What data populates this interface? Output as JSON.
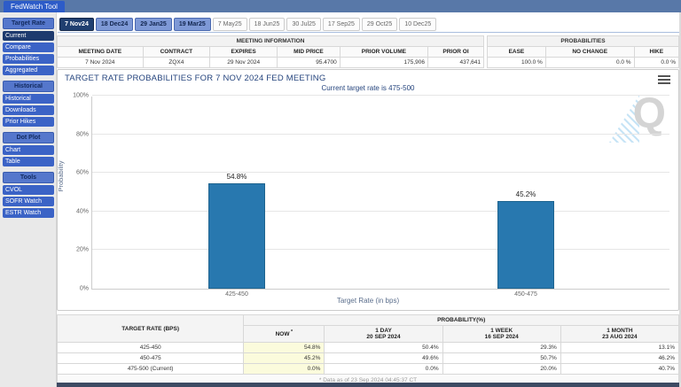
{
  "header": {
    "app_title": "FedWatch Tool"
  },
  "sidebar": {
    "sections": [
      {
        "label": "Target Rate",
        "items": [
          {
            "label": "Current",
            "active": true
          },
          {
            "label": "Compare",
            "active": false
          },
          {
            "label": "Probabilities",
            "active": false
          },
          {
            "label": "Aggregated",
            "active": false
          }
        ]
      },
      {
        "label": "Historical",
        "items": [
          {
            "label": "Historical",
            "active": false
          },
          {
            "label": "Downloads",
            "active": false
          },
          {
            "label": "Prior Hikes",
            "active": false
          }
        ]
      },
      {
        "label": "Dot Plot",
        "items": [
          {
            "label": "Chart",
            "active": false
          },
          {
            "label": "Table",
            "active": false
          }
        ]
      },
      {
        "label": "Tools",
        "items": [
          {
            "label": "CVOL",
            "active": false
          },
          {
            "label": "SOFR Watch",
            "active": false
          },
          {
            "label": "ESTR Watch",
            "active": false
          }
        ]
      }
    ]
  },
  "tabs": [
    {
      "label": "7 Nov24",
      "state": "selected"
    },
    {
      "label": "18 Dec24",
      "state": "highlighted"
    },
    {
      "label": "29 Jan25",
      "state": "highlighted"
    },
    {
      "label": "19 Mar25",
      "state": "highlighted"
    },
    {
      "label": "7 May25",
      "state": "normal"
    },
    {
      "label": "18 Jun25",
      "state": "normal"
    },
    {
      "label": "30 Jul25",
      "state": "normal"
    },
    {
      "label": "17 Sep25",
      "state": "normal"
    },
    {
      "label": "29 Oct25",
      "state": "normal"
    },
    {
      "label": "10 Dec25",
      "state": "normal"
    }
  ],
  "meeting_info": {
    "title": "MEETING INFORMATION",
    "columns": [
      "MEETING DATE",
      "CONTRACT",
      "EXPIRES",
      "MID PRICE",
      "PRIOR VOLUME",
      "PRIOR OI"
    ],
    "values": [
      "7 Nov 2024",
      "ZQX4",
      "29 Nov 2024",
      "95.4700",
      "175,906",
      "437,641"
    ],
    "align": [
      "ctr",
      "ctr",
      "ctr",
      "num",
      "num",
      "num"
    ]
  },
  "probabilities_summary": {
    "title": "PROBABILITIES",
    "columns": [
      "EASE",
      "NO CHANGE",
      "HIKE"
    ],
    "values": [
      "100.0 %",
      "0.0 %",
      "0.0 %"
    ],
    "align": [
      "num",
      "num",
      "num"
    ]
  },
  "chart_data": {
    "type": "bar",
    "title": "TARGET RATE PROBABILITIES FOR 7 NOV 2024 FED MEETING",
    "subtitle": "Current target rate is 475-500",
    "categories": [
      "425-450",
      "450-475"
    ],
    "values": [
      54.8,
      45.2
    ],
    "value_labels": [
      "54.8%",
      "45.2%"
    ],
    "xlabel": "Target Rate (in bps)",
    "ylabel": "Probability",
    "ylim": [
      0,
      100
    ],
    "yticks": [
      0,
      20,
      40,
      60,
      80,
      100
    ],
    "ytick_labels": [
      "0%",
      "20%",
      "40%",
      "60%",
      "80%",
      "100%"
    ],
    "grid": true,
    "legend": false,
    "bar_color": "#2878af"
  },
  "probability_table": {
    "rate_header": "TARGET RATE (BPS)",
    "group_header": "PROBABILITY(%)",
    "now_header": "NOW",
    "now_mark": "*",
    "period_headers": [
      {
        "line1": "1 DAY",
        "line2": "20 SEP 2024"
      },
      {
        "line1": "1 WEEK",
        "line2": "16 SEP 2024"
      },
      {
        "line1": "1 MONTH",
        "line2": "23 AUG 2024"
      }
    ],
    "rows": [
      {
        "rate": "425-450",
        "now": "54.8%",
        "day": "50.4%",
        "week": "29.3%",
        "month": "13.1%"
      },
      {
        "rate": "450-475",
        "now": "45.2%",
        "day": "49.6%",
        "week": "50.7%",
        "month": "46.2%"
      },
      {
        "rate": "475-500 (Current)",
        "now": "0.0%",
        "day": "0.0%",
        "week": "20.0%",
        "month": "40.7%"
      }
    ],
    "footnote": "* Data as of 23 Sep 2024 04:45:37 CT"
  },
  "colors": {
    "topbar": "#5878a8",
    "app_tab": "#2d5cc8",
    "sidebar_item": "#3b63c6",
    "sidebar_active": "#1e3a6e",
    "tab_selected": "#203f70",
    "tab_highlighted": "#7e99d6",
    "bar": "#2878af",
    "now_highlight": "#fbfbdc",
    "title_navy": "#26457e"
  },
  "icons": {
    "menu": "hamburger-icon",
    "watermark_letter": "Q"
  }
}
